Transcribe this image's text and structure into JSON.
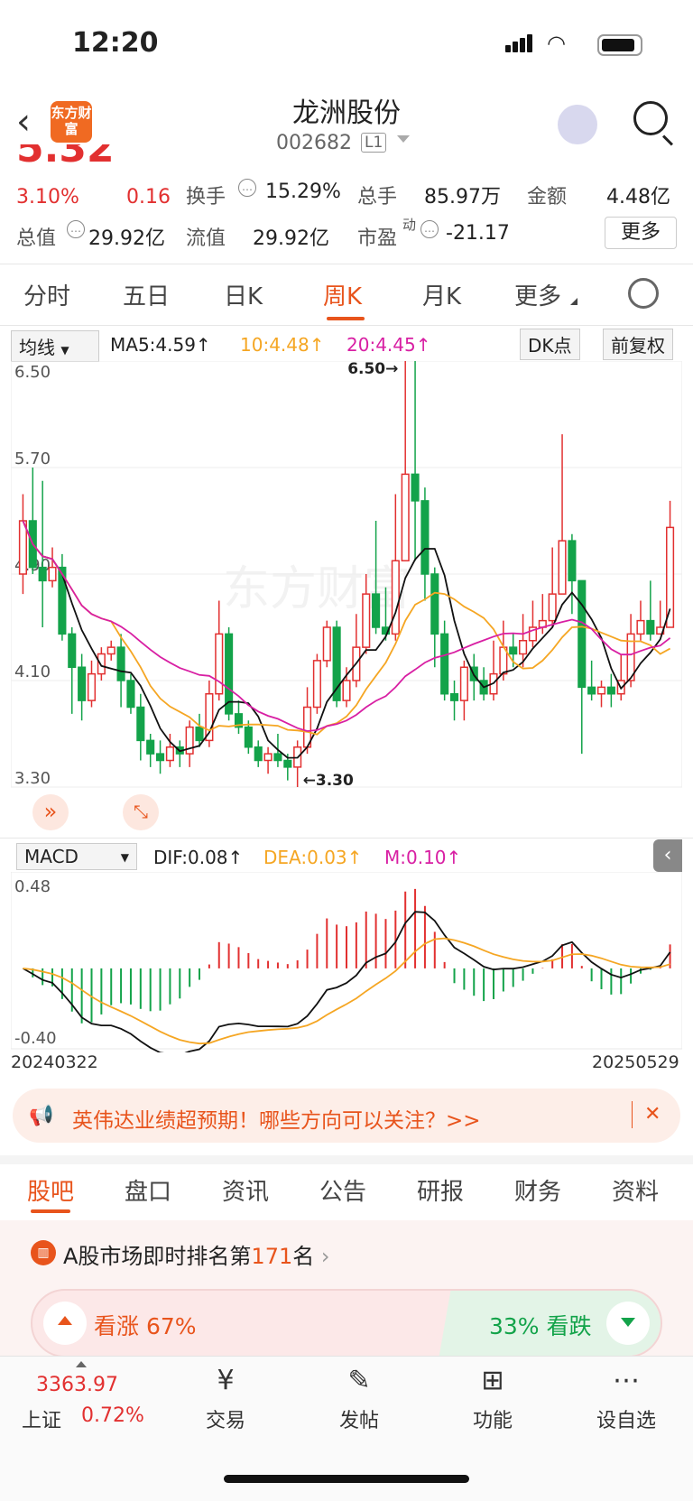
{
  "status_bar": {
    "time": "12:20"
  },
  "header": {
    "back": "‹",
    "logo": "东方财富",
    "title": "龙洲股份",
    "code": "002682",
    "level": "L1",
    "search_icon": "search-icon",
    "assistant_icon": "robot-icon"
  },
  "quote": {
    "change_pct": "3.10%",
    "change": "0.16",
    "turnover_label": "换手",
    "turnover": "15.29%",
    "total_hand_label": "总手",
    "total_hand": "85.97万",
    "amount_label": "金额",
    "amount": "4.48亿",
    "market_cap_label": "总值",
    "market_cap": "29.92亿",
    "float_cap_label": "流值",
    "float_cap": "29.92亿",
    "pe_label": "市盈",
    "pe_sup": "动",
    "pe": "-21.17",
    "more_label": "更多"
  },
  "period_tabs": [
    {
      "label": "分时"
    },
    {
      "label": "五日"
    },
    {
      "label": "日K"
    },
    {
      "label": "周K",
      "active": true
    },
    {
      "label": "月K"
    },
    {
      "label": "更多"
    }
  ],
  "chart_toolbar": {
    "indicator": "均线",
    "ma5": "MA5:4.59↑",
    "ma10": "10:4.48↑",
    "ma20": "20:4.45↑",
    "dk": "DK点",
    "adjust": "前复权"
  },
  "macd_toolbar": {
    "indicator": "MACD",
    "dif": "DIF:0.08↑",
    "dea": "DEA:0.03↑",
    "m": "M:0.10↑"
  },
  "colors": {
    "up": "#e23030",
    "down": "#13a34a",
    "ma10": "#f5a623",
    "ma20": "#d81fa3",
    "accent": "#e8541c"
  },
  "chart_data": [
    {
      "type": "candlestick",
      "title": "周K",
      "y_ticks": [
        "6.50",
        "5.70",
        "4.90",
        "4.10",
        "3.30"
      ],
      "ylim": [
        3.3,
        6.5
      ],
      "annotations": [
        "6.50→",
        "←3.30"
      ],
      "watermark": "东方财富",
      "candles": [
        [
          4.9,
          5.3,
          5.5,
          4.75
        ],
        [
          5.3,
          4.95,
          5.7,
          4.9
        ],
        [
          4.95,
          4.85,
          5.6,
          4.5
        ],
        [
          4.85,
          4.95,
          5.1,
          4.8
        ],
        [
          4.95,
          4.45,
          5.05,
          4.4
        ],
        [
          4.45,
          4.2,
          4.5,
          3.85
        ],
        [
          4.2,
          3.95,
          4.3,
          3.8
        ],
        [
          3.95,
          4.15,
          4.25,
          3.9
        ],
        [
          4.15,
          4.3,
          4.35,
          4.1
        ],
        [
          4.3,
          4.35,
          4.4,
          4.25
        ],
        [
          4.35,
          4.1,
          4.45,
          3.9
        ],
        [
          4.1,
          3.9,
          4.15,
          3.85
        ],
        [
          3.9,
          3.65,
          4.0,
          3.5
        ],
        [
          3.65,
          3.55,
          3.7,
          3.45
        ],
        [
          3.55,
          3.5,
          3.65,
          3.4
        ],
        [
          3.5,
          3.6,
          3.7,
          3.45
        ],
        [
          3.6,
          3.55,
          3.65,
          3.45
        ],
        [
          3.55,
          3.75,
          3.8,
          3.45
        ],
        [
          3.75,
          3.65,
          3.85,
          3.6
        ],
        [
          3.65,
          4.0,
          4.1,
          3.6
        ],
        [
          4.0,
          4.45,
          4.7,
          3.95
        ],
        [
          4.45,
          3.85,
          4.5,
          3.8
        ],
        [
          3.85,
          3.75,
          3.95,
          3.7
        ],
        [
          3.75,
          3.6,
          3.8,
          3.55
        ],
        [
          3.6,
          3.5,
          3.65,
          3.45
        ],
        [
          3.5,
          3.55,
          3.6,
          3.4
        ],
        [
          3.55,
          3.5,
          3.7,
          3.45
        ],
        [
          3.5,
          3.45,
          3.55,
          3.35
        ],
        [
          3.45,
          3.6,
          3.65,
          3.3
        ],
        [
          3.6,
          3.9,
          4.05,
          3.55
        ],
        [
          3.9,
          4.25,
          4.3,
          3.85
        ],
        [
          4.25,
          4.5,
          4.55,
          4.2
        ],
        [
          4.5,
          3.95,
          4.55,
          3.9
        ],
        [
          3.95,
          4.1,
          4.2,
          3.9
        ],
        [
          4.1,
          4.35,
          4.6,
          4.05
        ],
        [
          4.35,
          4.75,
          4.9,
          4.3
        ],
        [
          4.75,
          4.5,
          5.3,
          4.45
        ],
        [
          4.5,
          4.45,
          4.8,
          4.4
        ],
        [
          4.45,
          5.0,
          5.5,
          4.4
        ],
        [
          5.0,
          5.65,
          6.5,
          5.0
        ],
        [
          5.65,
          5.45,
          6.5,
          5.0
        ],
        [
          5.45,
          4.9,
          5.55,
          4.7
        ],
        [
          4.9,
          4.45,
          4.95,
          4.2
        ],
        [
          4.45,
          4.0,
          4.55,
          3.95
        ],
        [
          4.0,
          3.95,
          4.1,
          3.8
        ],
        [
          3.95,
          4.2,
          4.25,
          3.8
        ],
        [
          4.2,
          4.1,
          4.3,
          3.95
        ],
        [
          4.1,
          4.0,
          4.2,
          3.95
        ],
        [
          4.0,
          4.15,
          4.4,
          3.95
        ],
        [
          4.15,
          4.35,
          4.55,
          4.1
        ],
        [
          4.35,
          4.3,
          4.45,
          4.2
        ],
        [
          4.3,
          4.4,
          4.6,
          4.2
        ],
        [
          4.4,
          4.5,
          4.7,
          4.35
        ],
        [
          4.5,
          4.55,
          4.75,
          4.45
        ],
        [
          4.55,
          4.75,
          5.1,
          4.5
        ],
        [
          4.75,
          5.15,
          5.95,
          4.75
        ],
        [
          5.15,
          4.85,
          5.2,
          4.6
        ],
        [
          4.85,
          4.05,
          4.85,
          3.55
        ],
        [
          4.05,
          4.0,
          4.25,
          3.95
        ],
        [
          4.0,
          4.05,
          4.1,
          3.9
        ],
        [
          4.05,
          4.0,
          4.15,
          3.9
        ],
        [
          4.0,
          4.1,
          4.3,
          3.95
        ],
        [
          4.1,
          4.45,
          4.6,
          4.05
        ],
        [
          4.45,
          4.55,
          4.7,
          4.4
        ],
        [
          4.55,
          4.45,
          4.85,
          4.4
        ],
        [
          4.45,
          4.5,
          4.7,
          4.45
        ],
        [
          4.5,
          5.25,
          5.45,
          4.5
        ]
      ]
    },
    {
      "type": "bar",
      "title": "MACD",
      "y_ticks": [
        "0.48",
        "-0.40"
      ],
      "ylim": [
        -0.4,
        0.48
      ],
      "x_start": "20240322",
      "x_end": "20250529"
    }
  ],
  "banner": {
    "text": "英伟达业绩超预期！哪些方向可以关注？>>",
    "close": "✕"
  },
  "section_tabs": [
    {
      "label": "股吧",
      "active": true
    },
    {
      "label": "盘口"
    },
    {
      "label": "资讯"
    },
    {
      "label": "公告"
    },
    {
      "label": "研报"
    },
    {
      "label": "财务"
    },
    {
      "label": "资料"
    }
  ],
  "ranking": {
    "prefix": "A股市场即时排名第",
    "rank": "171",
    "suffix": "名"
  },
  "vote": {
    "up_label": "看涨",
    "up_pct": "67%",
    "down_pct": "33%",
    "down_label": "看跌",
    "bull_fraction": 0.67
  },
  "bottom_nav": {
    "index_value": "3363.97",
    "index_name": "上证",
    "index_change": "0.72%",
    "items": [
      {
        "label": "交易",
        "icon": "trade-icon"
      },
      {
        "label": "发帖",
        "icon": "post-icon"
      },
      {
        "label": "功能",
        "icon": "apps-icon"
      },
      {
        "label": "设自选",
        "icon": "more-icon"
      }
    ]
  }
}
